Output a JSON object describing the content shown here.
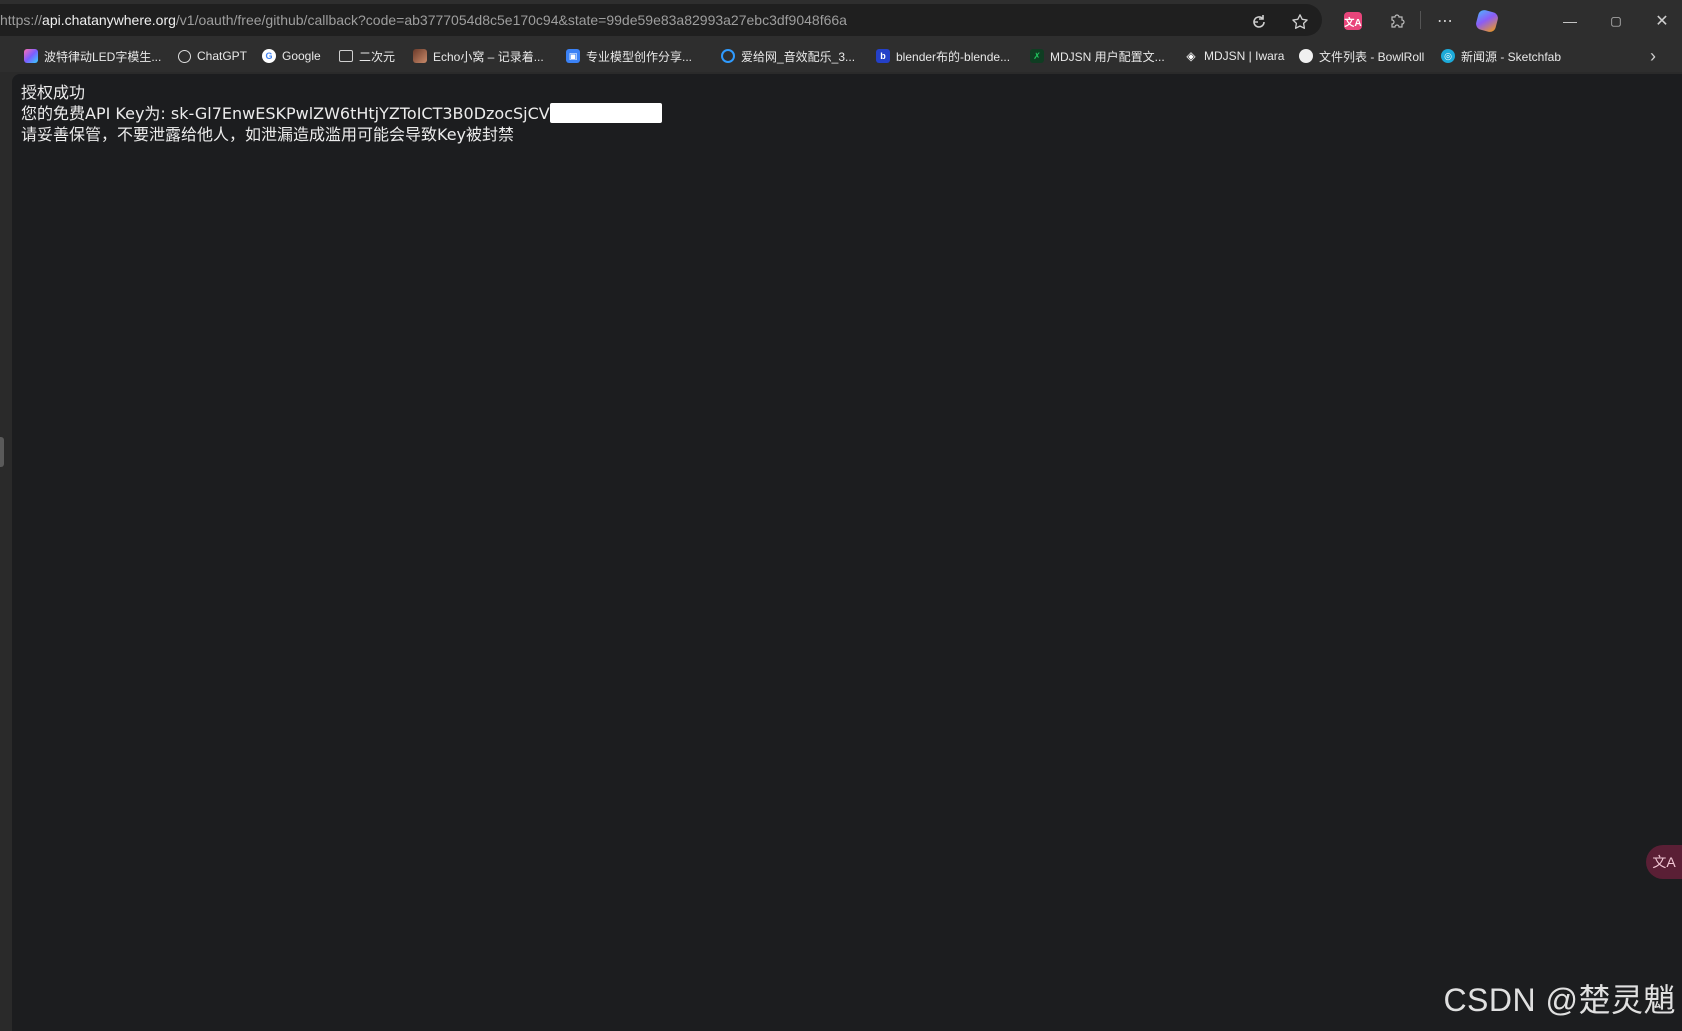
{
  "addressbar": {
    "url_prefix": "https://",
    "url_host": "api.chatanywhere.org",
    "url_rest": "/v1/oauth/free/github/callback?code=ab3777054d8c5e170c94&state=99de59e83a82993a27ebc3df9048f66a",
    "icons": [
      "refresh-icon",
      "star-icon",
      "translate-extension-icon",
      "extensions-icon",
      "more-icon",
      "copilot-icon",
      "minimize-icon",
      "restore-icon",
      "close-icon"
    ]
  },
  "bookmarks": [
    {
      "label": "波特律动LED字模生...",
      "icon": "bookmark-led-icon",
      "icon_color": "#7c5cff"
    },
    {
      "label": "ChatGPT",
      "icon": "chatgpt-icon",
      "icon_color": "#ffffff"
    },
    {
      "label": "Google",
      "icon": "google-icon",
      "icon_color": "#ffffff"
    },
    {
      "label": "二次元",
      "icon": "folder-icon",
      "icon_color": "#cfcfcf"
    },
    {
      "label": "Echo小窝 – 记录着...",
      "icon": "echo-icon",
      "icon_color": "#a0522d"
    },
    {
      "label": "专业模型创作分享...",
      "icon": "model-share-icon",
      "icon_color": "#3b82f6"
    },
    {
      "label": "爱给网_音效配乐_3...",
      "icon": "aigei-icon",
      "icon_color": "#2f9bff"
    },
    {
      "label": "blender布的-blende...",
      "icon": "blender-icon",
      "icon_color": "#2440c8"
    },
    {
      "label": "MDJSN 用户配置文...",
      "icon": "mdjsn-icon",
      "icon_color": "#16a34a"
    },
    {
      "label": "MDJSN | Iwara",
      "icon": "iwara-icon",
      "icon_color": "#ffffff"
    },
    {
      "label": "文件列表 - BowlRoll",
      "icon": "bowlroll-icon",
      "icon_color": "#ffffff"
    },
    {
      "label": "新闻源 - Sketchfab",
      "icon": "sketchfab-icon",
      "icon_color": "#1caad9"
    }
  ],
  "content": {
    "line1": "授权成功",
    "line2_prefix": "您的免费API Key为: sk-Gl7EnwESKPwlZW6tHtjYZToICT3B0DzocSjCV",
    "line3": "请妥善保管，不要泄露给他人，如泄漏造成滥用可能会导致Key被封禁"
  },
  "watermark": "CSDN @楚灵魈",
  "colors": {
    "page_bg": "#1c1d1f",
    "chrome_bg": "#2e2e2e",
    "accent_pink": "#e8457b"
  }
}
